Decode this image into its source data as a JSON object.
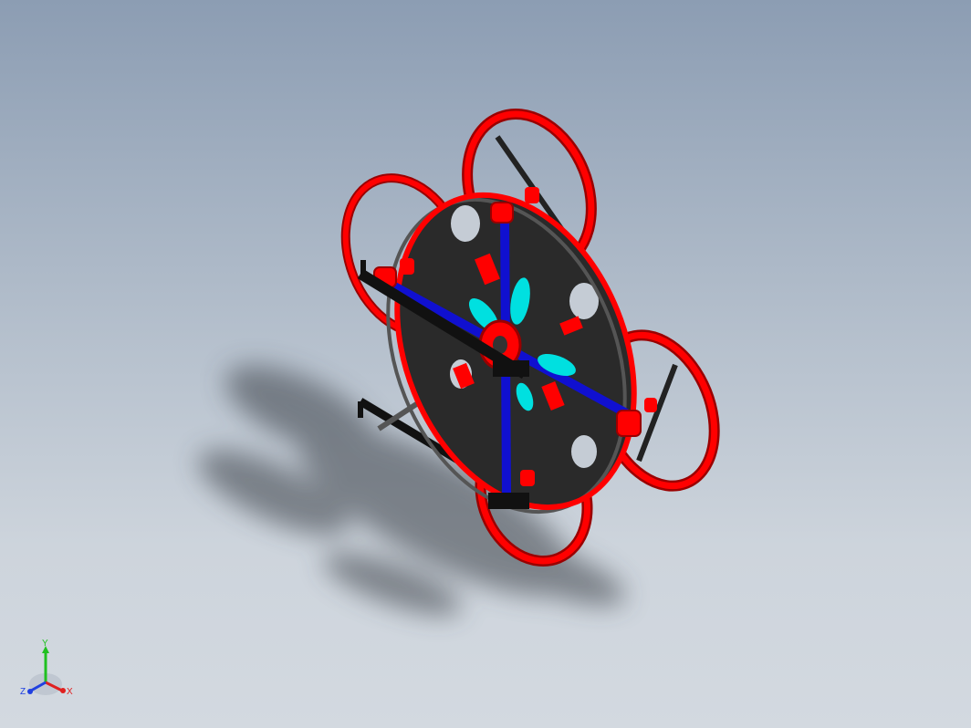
{
  "viewport": {
    "background_top": "#8c9db3",
    "background_bottom": "#d3d9e0"
  },
  "model": {
    "colors": {
      "rim": "#ff0000",
      "rim_shade": "#9a0000",
      "plate": "#2a2a2a",
      "spoke": "#1010d0",
      "propeller": "#00e0e0",
      "rod": "#555555",
      "skid": "#111111"
    }
  },
  "triad": {
    "x_label": "X",
    "y_label": "Y",
    "z_label": "Z",
    "x_color": "#e02020",
    "y_color": "#20c020",
    "z_color": "#2040e0"
  }
}
